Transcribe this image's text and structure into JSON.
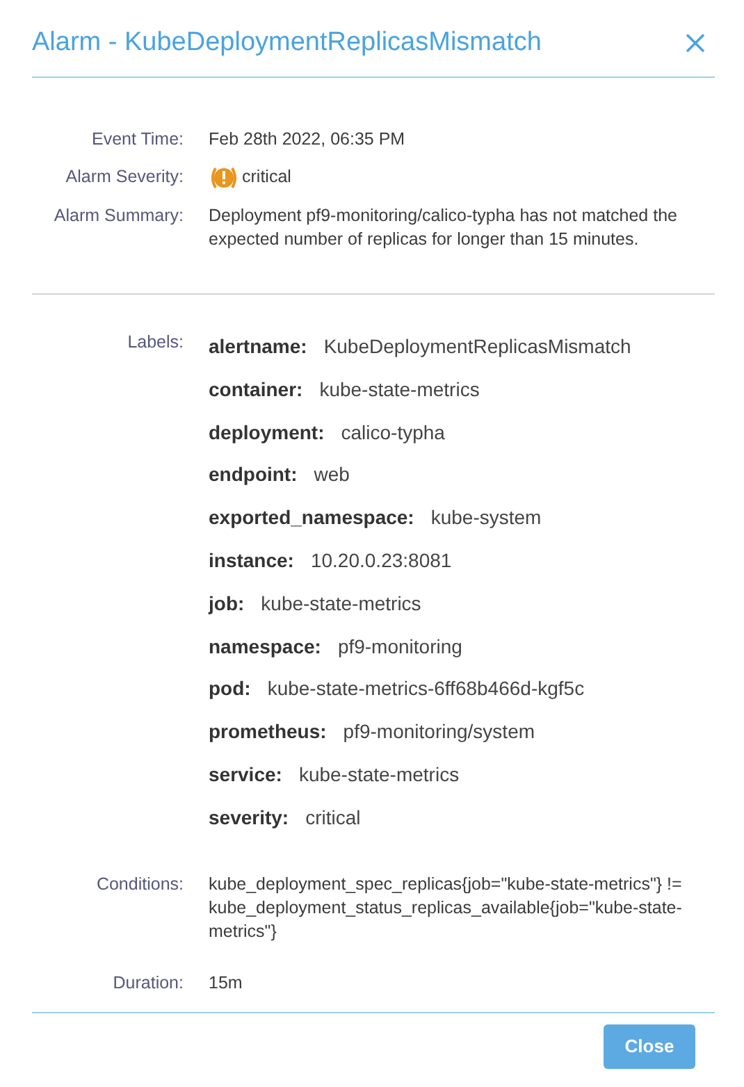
{
  "dialog": {
    "title": "Alarm - KubeDeploymentReplicasMismatch"
  },
  "details": [
    {
      "label": "Event Time:",
      "value": "Feb 28th 2022, 06:35 PM"
    },
    {
      "label": "Alarm Severity:",
      "value": "critical",
      "kind": "severity"
    },
    {
      "label": "Alarm Summary:",
      "value": "Deployment pf9-monitoring/calico-typha has not matched the expected number of replicas for longer than 15 minutes."
    }
  ],
  "labels": {
    "heading": "Labels:",
    "items": [
      {
        "key": "alertname:",
        "value": "KubeDeploymentReplicasMismatch"
      },
      {
        "key": "container:",
        "value": "kube-state-metrics"
      },
      {
        "key": "deployment:",
        "value": "calico-typha"
      },
      {
        "key": "endpoint:",
        "value": "web"
      },
      {
        "key": "exported_namespace:",
        "value": "kube-system"
      },
      {
        "key": "instance:",
        "value": "10.20.0.23:8081"
      },
      {
        "key": "job:",
        "value": "kube-state-metrics"
      },
      {
        "key": "namespace:",
        "value": "pf9-monitoring"
      },
      {
        "key": "pod:",
        "value": "kube-state-metrics-6ff68b466d-kgf5c"
      },
      {
        "key": "prometheus:",
        "value": "pf9-monitoring/system"
      },
      {
        "key": "service:",
        "value": "kube-state-metrics"
      },
      {
        "key": "severity:",
        "value": "critical"
      }
    ]
  },
  "extra": [
    {
      "label": "Conditions:",
      "value": "kube_deployment_spec_replicas{job=\"kube-state-metrics\"} != kube_deployment_status_replicas_available{job=\"kube-state-metrics\"}"
    },
    {
      "label": "Duration:",
      "value": "15m"
    }
  ],
  "buttons": [
    "Close"
  ]
}
